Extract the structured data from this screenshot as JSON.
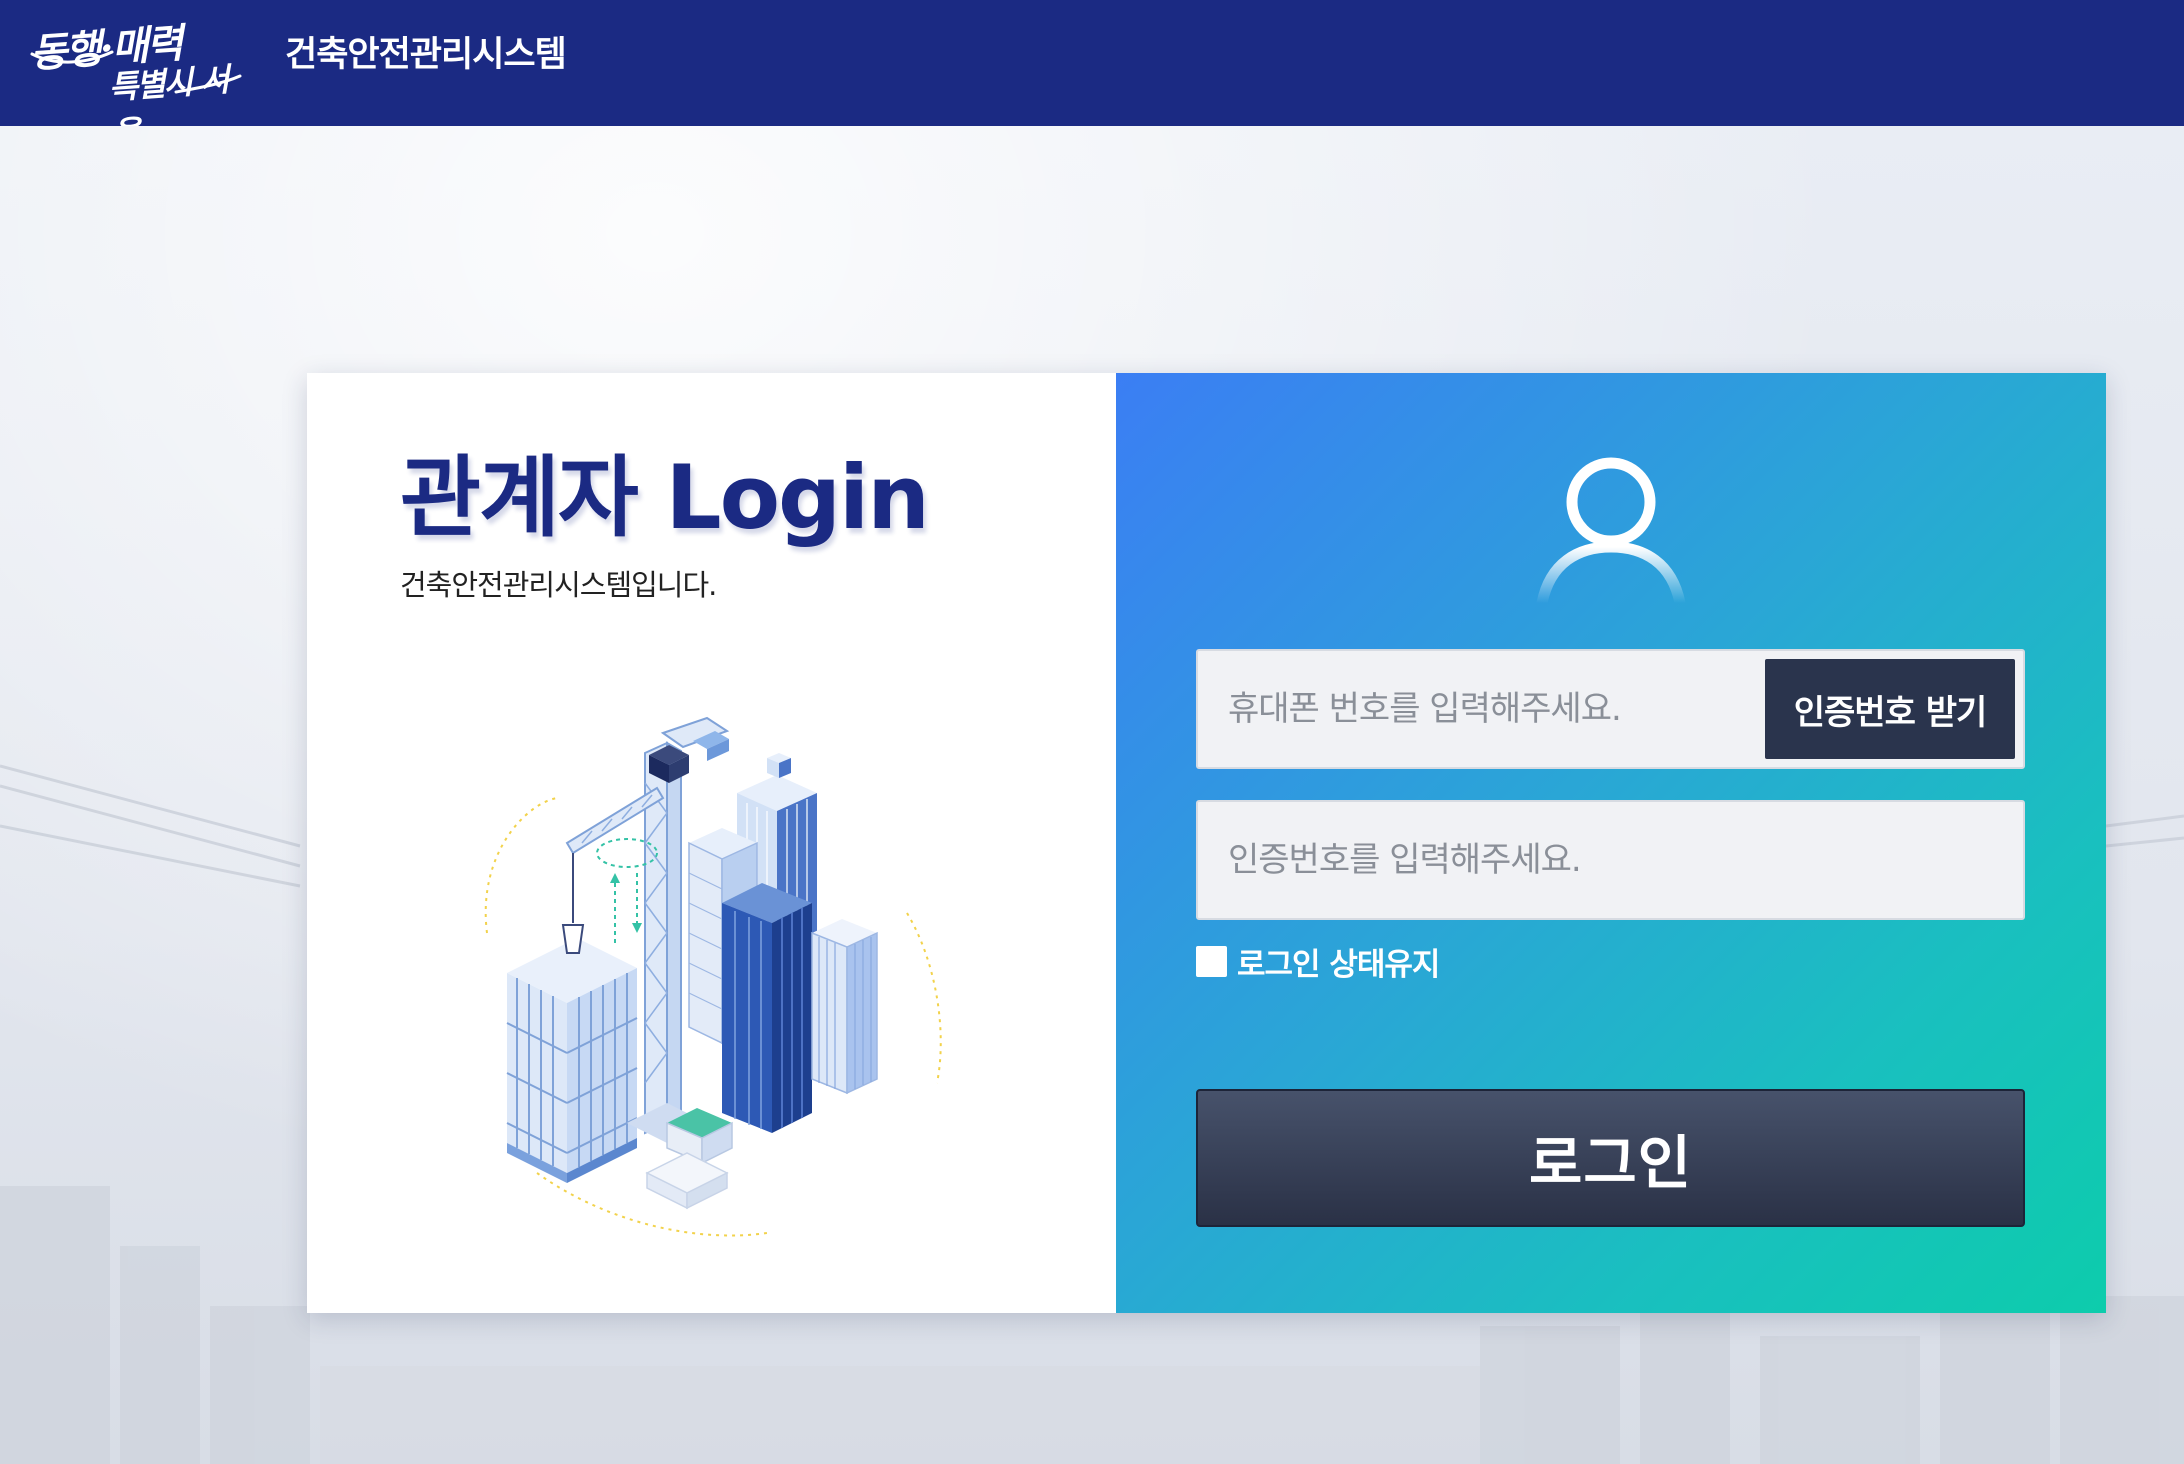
{
  "header": {
    "logo_line1": "동행·매력",
    "logo_line2": "특별시 서울",
    "system_title": "건축안전관리시스템"
  },
  "login_panel": {
    "title": "관계자 Login",
    "subtitle": "건축안전관리시스템입니다."
  },
  "form": {
    "phone_placeholder": "휴대폰 번호를 입력해주세요.",
    "phone_value": "",
    "get_code_label": "인증번호 받기",
    "code_placeholder": "인증번호를 입력해주세요.",
    "code_value": "",
    "remember_label": "로그인 상태유지",
    "remember_checked": false,
    "login_label": "로그인"
  },
  "icons": {
    "user": "user-icon",
    "illustration": "construction-illustration"
  },
  "colors": {
    "header": "#1b2a83",
    "title": "#1b2a83",
    "gradient_start": "#3b7ef4",
    "gradient_end": "#0dccac",
    "button_dark": "#2a344d"
  }
}
